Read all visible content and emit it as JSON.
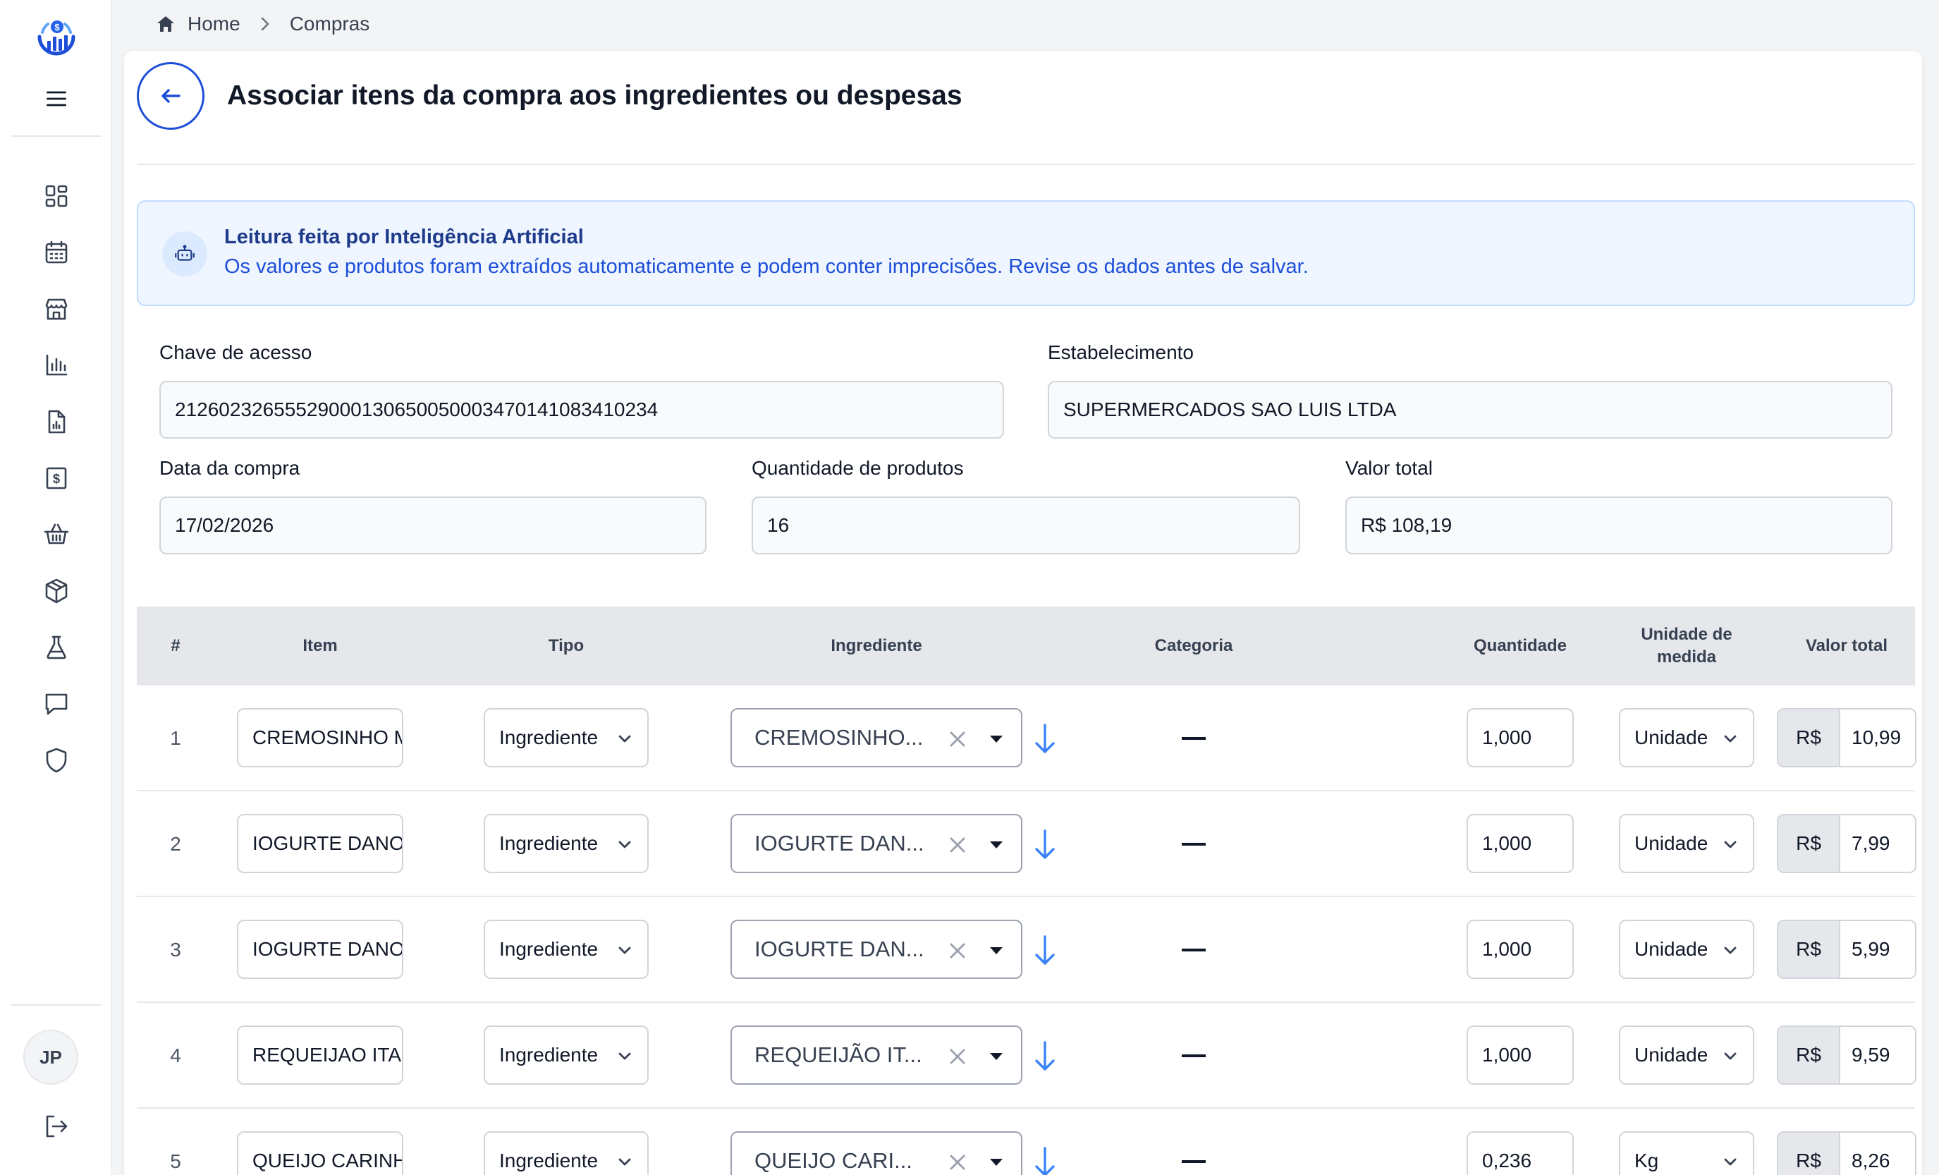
{
  "breadcrumb": {
    "home": "Home",
    "current": "Compras"
  },
  "page": {
    "title": "Associar itens da compra aos ingredientes ou despesas"
  },
  "ai_banner": {
    "title": "Leitura feita por Inteligência Artificial",
    "message": "Os valores e produtos foram extraídos automaticamente e podem conter imprecisões. Revise os dados antes de salvar."
  },
  "fields": {
    "chave_label": "Chave de acesso",
    "chave_value": "21260232655529000130650050003470141083410234",
    "estabelecimento_label": "Estabelecimento",
    "estabelecimento_value": "SUPERMERCADOS SAO LUIS LTDA",
    "data_label": "Data da compra",
    "data_value": "17/02/2026",
    "quantidade_label": "Quantidade de produtos",
    "quantidade_value": "16",
    "valor_label": "Valor total",
    "valor_value": "R$ 108,19"
  },
  "table": {
    "headers": {
      "num": "#",
      "item": "Item",
      "tipo": "Tipo",
      "ingrediente": "Ingrediente",
      "categoria": "Categoria",
      "quantidade": "Quantidade",
      "unidade": "Unidade de medida",
      "valor": "Valor total"
    },
    "currency": "R$",
    "rows": [
      {
        "num": "1",
        "item": "CREMOSINHO MIRA",
        "tipo": "Ingrediente",
        "ingrediente": "CREMOSINHO...",
        "quantidade": "1,000",
        "unidade": "Unidade",
        "valor": "10,99"
      },
      {
        "num": "2",
        "item": "IOGURTE DANONE",
        "tipo": "Ingrediente",
        "ingrediente": "IOGURTE DAN...",
        "quantidade": "1,000",
        "unidade": "Unidade",
        "valor": "7,99"
      },
      {
        "num": "3",
        "item": "IOGURTE DANONE",
        "tipo": "Ingrediente",
        "ingrediente": "IOGURTE DAN...",
        "quantidade": "1,000",
        "unidade": "Unidade",
        "valor": "5,99"
      },
      {
        "num": "4",
        "item": "REQUEIJAO ITACOLOMY",
        "tipo": "Ingrediente",
        "ingrediente": "REQUEIJÃO IT...",
        "quantidade": "1,000",
        "unidade": "Unidade",
        "valor": "9,59"
      },
      {
        "num": "5",
        "item": "QUEIJO CARINHOSO",
        "tipo": "Ingrediente",
        "ingrediente": "QUEIJO CARI...",
        "quantidade": "0,236",
        "unidade": "Kg",
        "valor": "8,26"
      }
    ]
  },
  "user": {
    "initials": "JP"
  },
  "colors": {
    "accent": "#1d4ed8",
    "banner_bg": "#eff6ff",
    "icon_blue": "#3b82f6"
  }
}
